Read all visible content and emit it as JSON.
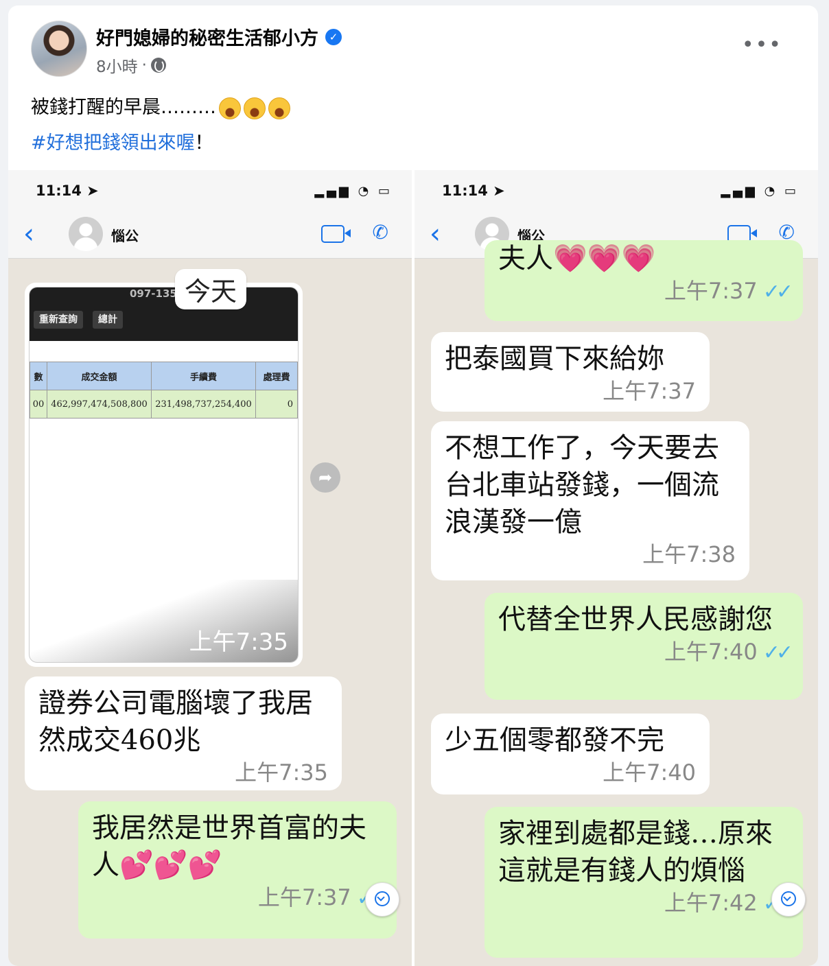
{
  "post": {
    "author": "好門媳婦的秘密生活郁小方",
    "time": "8小時",
    "dot": "·",
    "text_line1": "被錢打醒的早晨………",
    "hashtag": "#好想把錢領出來喔",
    "hashtag_suffix": "！"
  },
  "phone": {
    "time": "11:14",
    "contact": "惱公"
  },
  "left_chat": {
    "date_badge": "今天",
    "image": {
      "account": "097-135",
      "buttons": [
        "重新查詢",
        "總計"
      ],
      "table_headers": [
        "數",
        "成交金額",
        "手續費",
        "處理費"
      ],
      "table_row": [
        "00",
        "462,997,474,508,800",
        "231,498,737,254,400",
        "0"
      ],
      "time": "上午7:35"
    },
    "messages": [
      {
        "text": "證券公司電腦壞了我居然成交460兆",
        "time": "上午7:35"
      },
      {
        "text": "我居然是世界首富的夫人💕💕💕",
        "time": "上午7:37"
      }
    ]
  },
  "right_chat": {
    "messages": [
      {
        "text": "夫人💗💗💗",
        "time": "上午7:37"
      },
      {
        "text": "把泰國買下來給妳",
        "time": "上午7:37"
      },
      {
        "text": "不想工作了，今天要去台北車站發錢，一個流浪漢發一億",
        "time": "上午7:38"
      },
      {
        "text": "代替全世界人民感謝您",
        "time": "上午7:40"
      },
      {
        "text": "少五個零都發不完",
        "time": "上午7:40"
      },
      {
        "text": "家裡到處都是錢…原來這就是有錢人的煩惱",
        "time": "上午7:42"
      }
    ]
  }
}
